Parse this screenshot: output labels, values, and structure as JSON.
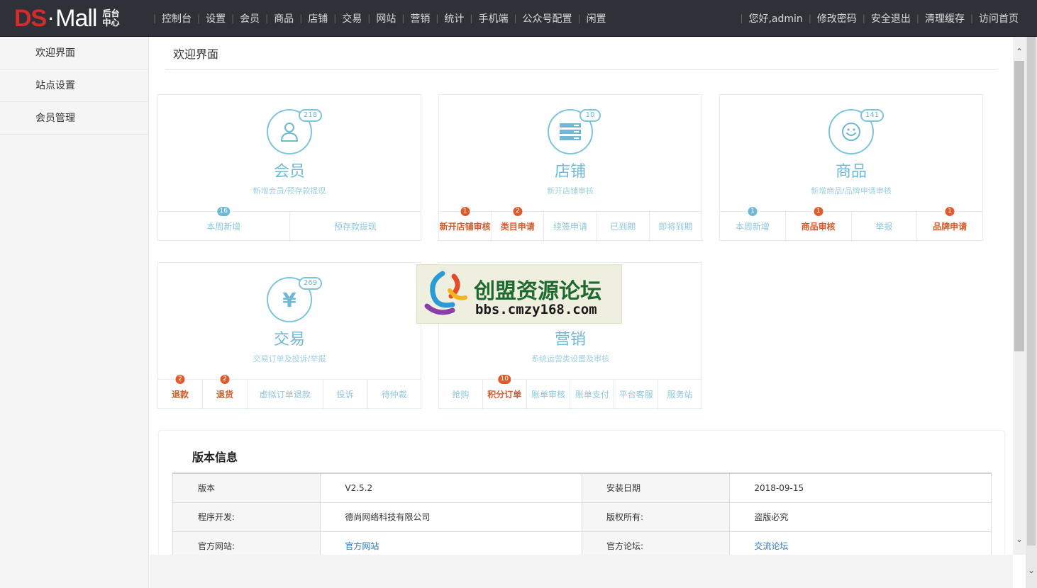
{
  "logo": {
    "ds": "DS",
    "dot": "·",
    "mall": "Mall",
    "sub": "后台中心"
  },
  "topnav": [
    "控制台",
    "设置",
    "会员",
    "商品",
    "店铺",
    "交易",
    "网站",
    "营销",
    "统计",
    "手机端",
    "公众号配置",
    "闲置"
  ],
  "usernav": [
    "您好,admin",
    "修改密码",
    "安全退出",
    "清理缓存",
    "访问首页"
  ],
  "sidebar": [
    "欢迎界面",
    "站点设置",
    "会员管理"
  ],
  "page_title": "欢迎界面",
  "cards": {
    "member": {
      "title": "会员",
      "desc": "新增会员/预存款提现",
      "count": "218",
      "links": [
        {
          "label": "本周新增",
          "badge": "16"
        },
        {
          "label": "预存款提现"
        }
      ]
    },
    "store": {
      "title": "店铺",
      "desc": "新开店铺审核",
      "count": "10",
      "links": [
        {
          "label": "新开店铺审核",
          "badge": "1"
        },
        {
          "label": "类目申请",
          "badge": "2"
        },
        {
          "label": "续签申请"
        },
        {
          "label": "已到期"
        },
        {
          "label": "即将到期"
        }
      ]
    },
    "goods": {
      "title": "商品",
      "desc": "新增商品/品牌申请审核",
      "count": "141",
      "links": [
        {
          "label": "本周新增",
          "badge": "1"
        },
        {
          "label": "商品审核",
          "badge": "1"
        },
        {
          "label": "举报"
        },
        {
          "label": "品牌申请",
          "badge": "1"
        }
      ]
    },
    "trade": {
      "title": "交易",
      "desc": "交易订单及投诉/举报",
      "count": "269",
      "links": [
        {
          "label": "退款",
          "badge": "2"
        },
        {
          "label": "退货",
          "badge": "2"
        },
        {
          "label": "虚拟订单退款"
        },
        {
          "label": "投诉"
        },
        {
          "label": "待仲裁"
        }
      ]
    },
    "marketing": {
      "title": "营销",
      "desc": "系统运营类设置及审核",
      "links": [
        {
          "label": "抢购"
        },
        {
          "label": "积分订单",
          "badge": "10"
        },
        {
          "label": "账单审核"
        },
        {
          "label": "账单支付"
        },
        {
          "label": "平台客服"
        },
        {
          "label": "服务站"
        }
      ]
    }
  },
  "watermark": {
    "title": "创盟资源论坛",
    "url": "bbs.cmzy168.com"
  },
  "version": {
    "heading": "版本信息",
    "rows": [
      {
        "k1": "版本",
        "v1": "V2.5.2",
        "k2": "安装日期",
        "v2": "2018-09-15"
      },
      {
        "k1": "程序开发:",
        "v1": "德尚网络科技有限公司",
        "k2": "版权所有:",
        "v2": "盗版必究"
      },
      {
        "k1": "官方网站:",
        "v1": "官方网站",
        "k2": "官方论坛:",
        "v2": "交流论坛"
      }
    ]
  },
  "colors": {
    "topbar": "#2e3238",
    "accent": "#6fb9d6",
    "hot": "#d65b2b",
    "logo_red": "#d52b2b"
  }
}
